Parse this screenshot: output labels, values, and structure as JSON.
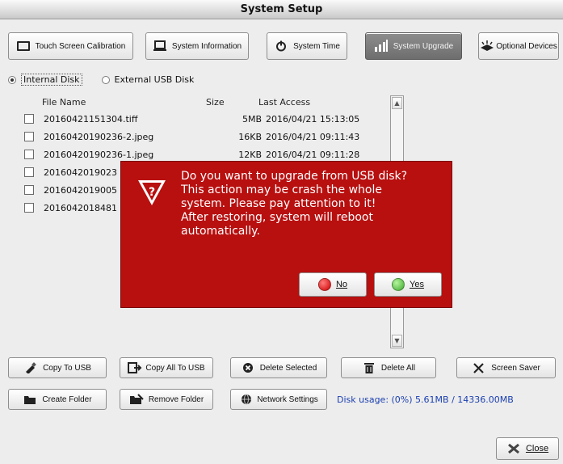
{
  "window": {
    "title": "System Setup"
  },
  "top_buttons": [
    {
      "label": "Touch Screen Calibration",
      "icon": "monitor-icon"
    },
    {
      "label": "System Information",
      "icon": "laptop-icon"
    },
    {
      "label": "System Time",
      "icon": "power-icon"
    },
    {
      "label": "System Upgrade",
      "icon": "signal-bars-icon",
      "active": true
    },
    {
      "label": "Optional Devices",
      "icon": "device-icon"
    }
  ],
  "disk_select": {
    "internal_label": "Internal Disk",
    "external_label": "External USB Disk",
    "selected": "Internal Disk"
  },
  "file_list": {
    "columns": {
      "name": "File Name",
      "size": "Size",
      "access": "Last Access"
    },
    "rows": [
      {
        "name": "20160421151304.tiff",
        "size": "5MB",
        "access": "2016/04/21 15:13:05"
      },
      {
        "name": "20160420190236-2.jpeg",
        "size": "16KB",
        "access": "2016/04/21 09:11:43"
      },
      {
        "name": "20160420190236-1.jpeg",
        "size": "12KB",
        "access": "2016/04/21 09:11:28"
      },
      {
        "name": "2016042019023",
        "size": "",
        "access": ""
      },
      {
        "name": "2016042019005",
        "size": "",
        "access": ""
      },
      {
        "name": "2016042018481",
        "size": "",
        "access": ""
      }
    ]
  },
  "dialog": {
    "message": "Do you want to upgrade from USB disk?\nThis action may be crash the whole\nsystem. Please pay attention to it!\nAfter restoring, system will reboot\nautomatically.",
    "no_label": "No",
    "yes_label": "Yes",
    "colors": {
      "background": "#b80f0f",
      "no_dot": "#d81818",
      "yes_dot": "#4cc23a"
    }
  },
  "bottom_buttons": {
    "copy_to_usb": "Copy To USB",
    "copy_all_to_usb": "Copy All To USB",
    "delete_selected": "Delete Selected",
    "delete_all": "Delete All",
    "screen_saver": "Screen Saver",
    "create_folder": "Create Folder",
    "remove_folder": "Remove Folder",
    "network_settings": "Network Settings",
    "close": "Close"
  },
  "disk_usage": "Disk usage: (0%) 5.61MB / 14336.00MB"
}
